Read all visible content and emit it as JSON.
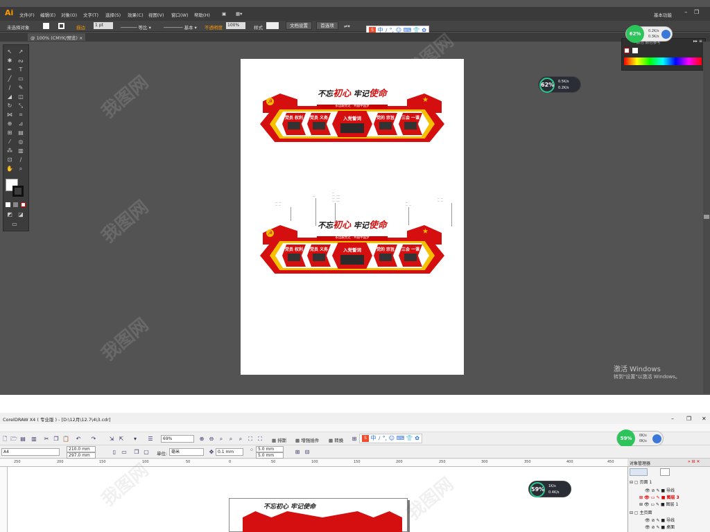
{
  "illustrator": {
    "logo": "Ai",
    "menu": [
      "文件(F)",
      "编辑(E)",
      "对象(O)",
      "文字(T)",
      "选择(S)",
      "效果(C)",
      "视图(V)",
      "窗口(W)",
      "帮助(H)"
    ],
    "workspace_label": "基本功能",
    "control_bar": {
      "selection": "未选择对象",
      "stroke_label": "描边",
      "stroke_weight": "1 pt",
      "profile_1": "等比",
      "profile_2": "基本",
      "opacity_label": "不透明度",
      "opacity_value": "100%",
      "style_label": "样式",
      "doc_setup_button": "文档设置",
      "prefs_button": "首选项"
    },
    "doc_tab": "@ 100% (CMYK/预览)",
    "swatch_panel_tabs": "颜色  颜色参考",
    "activation": {
      "line1": "激活 Windows",
      "line2": "转到\"设置\"以激活 Windows。"
    },
    "speed_widget": {
      "percent": "62%",
      "up": "0.5K/s",
      "down": "0.2K/s"
    },
    "tray_widget": {
      "percent": "62%",
      "up": "0.2K/s",
      "down": "0.3K/s"
    },
    "ime_chars": [
      "中",
      "ﾉ",
      "°,",
      "☺",
      "⌨",
      "👕",
      "✿"
    ],
    "artwork": {
      "slogan_left_plain": "不忘",
      "slogan_left_red": "初心",
      "slogan_right_plain": "牢记",
      "slogan_right_red": "使命",
      "subline": "永远跟党走 · 共圆中国梦",
      "panel_1": "党员 权利",
      "panel_2": "党员 义务",
      "center_panel": "入党誓词",
      "panel_4": "党的 宗旨",
      "panel_5": "三会 一课",
      "emblem": "☭",
      "star": "★"
    }
  },
  "coreldraw": {
    "title": "CorelDRAW X4 ( 专业版 ) - [D:\\12月\\12.7\\4\\3.cdr]",
    "window_controls": [
      "–",
      "❐",
      "✕"
    ],
    "toolbar": {
      "zoom": "69%",
      "sort_button": "排斯",
      "plugins_button": "增强插件",
      "convert_button": "转换"
    },
    "property_bar": {
      "page_size": "A4",
      "width": "210.0 mm",
      "height": "297.0 mm",
      "units_label": "单位:",
      "units_value": "毫米",
      "nudge": "0.1 mm",
      "dup_x": "5.0 mm",
      "dup_y": "5.0 mm"
    },
    "ruler_ticks": [
      "250",
      "200",
      "150",
      "100",
      "50",
      "0",
      "50",
      "100",
      "150",
      "200",
      "250",
      "300",
      "350",
      "400",
      "450"
    ],
    "speed_widget": {
      "percent": "59%",
      "up": "1K/s",
      "down": "0.4K/s"
    },
    "tray_widget": {
      "percent": "59%",
      "up": "0K/s",
      "down": "0K/s"
    },
    "object_manager": {
      "title": "对象管理器",
      "rows": [
        "页面 1",
        "导线",
        "图层 3",
        "图层 1",
        "主页面",
        "导线",
        "桌面"
      ]
    },
    "artwork_slogan": "不忘初心 牢记使命"
  },
  "watermark": "我图网",
  "colors": {
    "party_red": "#d50f0f",
    "gold": "#f6c000",
    "ai_bg": "#535353",
    "ai_accent": "#ff9a00"
  }
}
